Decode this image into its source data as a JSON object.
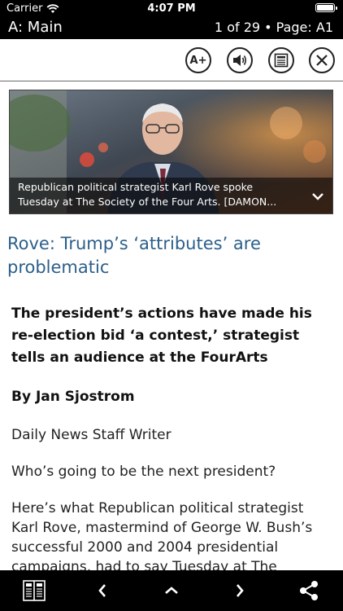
{
  "status_bar": {
    "carrier": "Carrier",
    "time": "4:07 PM"
  },
  "header": {
    "section": "A: Main",
    "page_info": "1 of 29 • Page: A1"
  },
  "toolbar": {
    "text_size_label": "A+",
    "icons": [
      "text-size-icon",
      "speaker-icon",
      "page-view-icon",
      "close-icon"
    ]
  },
  "photo": {
    "caption_line1": "Republican political strategist Karl Rove spoke",
    "caption_line2": "Tuesday at The Society of the Four Arts.  [DAMON..."
  },
  "article": {
    "headline": "Rove: Trump’s ‘attributes’ are problematic",
    "deck": "The president’s actions have made his re-election bid ‘a contest,’ strategist tells an audience at the FourArts",
    "byline": "By Jan Sjostrom",
    "paragraphs": [
      "Daily News Staff Writer",
      "Who’s going to be the next president?",
      "Here’s what Republican political strategist Karl Rove, mastermind of George W. Bush’s successful 2000 and 2004 presidential campaigns, had to say Tuesday at The"
    ]
  },
  "bottom_bar": {
    "icons": [
      "pages-icon",
      "chevron-left-icon",
      "chevron-up-icon",
      "chevron-right-icon",
      "share-icon"
    ]
  }
}
